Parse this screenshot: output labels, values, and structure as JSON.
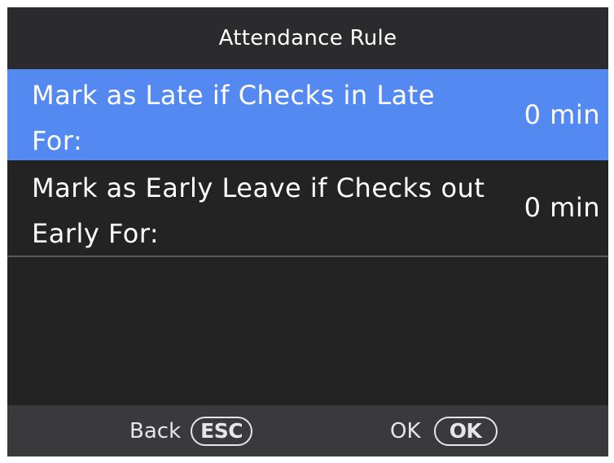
{
  "header": {
    "title": "Attendance Rule"
  },
  "rules": [
    {
      "label": "Mark as Late if Checks in Late For:",
      "value": "0 min",
      "selected": true
    },
    {
      "label": "Mark as Early Leave if Checks out Early For:",
      "value": "0 min",
      "selected": false
    }
  ],
  "footer": {
    "back_label": "Back",
    "back_key": "ESC",
    "ok_label": "OK",
    "ok_key": "OK"
  },
  "colors": {
    "selected_row": "#5589f2",
    "background": "#232323",
    "footer": "#3a3a3d"
  }
}
